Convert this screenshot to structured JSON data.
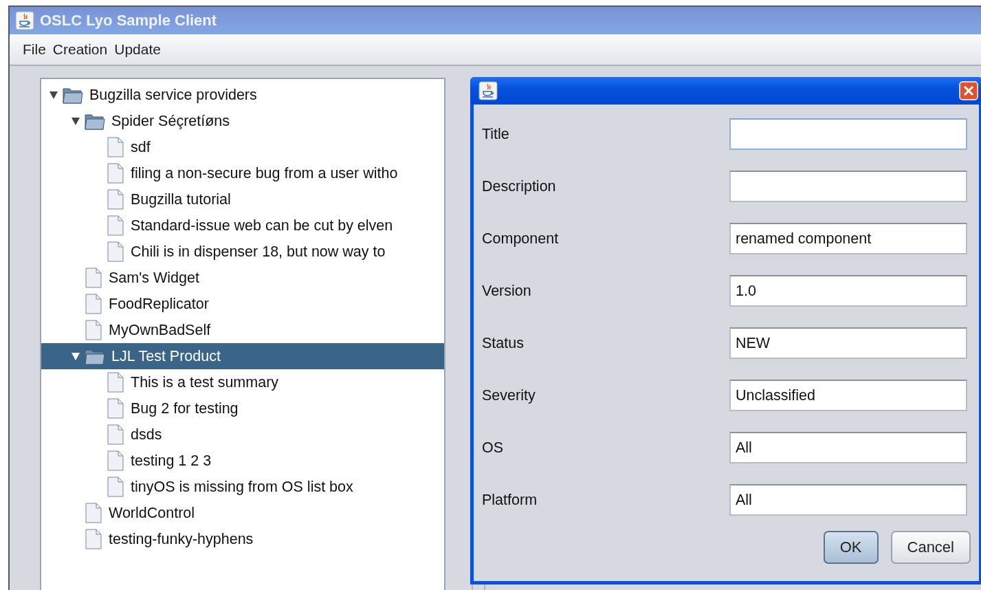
{
  "window": {
    "title": "OSLC Lyo Sample Client"
  },
  "menu": [
    "File",
    "Creation",
    "Update"
  ],
  "tree": [
    {
      "label": "Bugzilla service providers",
      "kind": "folder",
      "expanded": true,
      "selected": false,
      "children": [
        {
          "label": "Spider Séçretíøns",
          "kind": "folder",
          "expanded": true,
          "selected": false,
          "children": [
            {
              "label": "sdf",
              "kind": "file",
              "selected": false
            },
            {
              "label": "filing a non-secure bug from a user witho",
              "kind": "file",
              "selected": false
            },
            {
              "label": "Bugzilla tutorial",
              "kind": "file",
              "selected": false
            },
            {
              "label": "Standard-issue web can be cut by elven",
              "kind": "file",
              "selected": false
            },
            {
              "label": "Chili is in dispenser 18, but now way to",
              "kind": "file",
              "selected": false
            }
          ]
        },
        {
          "label": "Sam's Widget",
          "kind": "file",
          "selected": false
        },
        {
          "label": "FoodReplicator",
          "kind": "file",
          "selected": false
        },
        {
          "label": "MyOwnBadSelf",
          "kind": "file",
          "selected": false
        },
        {
          "label": "LJL Test Product",
          "kind": "folder",
          "expanded": true,
          "selected": true,
          "children": [
            {
              "label": "This is a test summary",
              "kind": "file",
              "selected": false
            },
            {
              "label": "Bug 2 for testing",
              "kind": "file",
              "selected": false
            },
            {
              "label": "dsds",
              "kind": "file",
              "selected": false
            },
            {
              "label": "testing 1 2 3",
              "kind": "file",
              "selected": false
            },
            {
              "label": "tinyOS is missing from OS list box",
              "kind": "file",
              "selected": false
            }
          ]
        },
        {
          "label": "WorldControl",
          "kind": "file",
          "selected": false
        },
        {
          "label": "testing-funky-hyphens",
          "kind": "file",
          "selected": false
        }
      ]
    }
  ],
  "dialog": {
    "fields": [
      {
        "label": "Title",
        "focused": true
      },
      {
        "label": "Description",
        "focused": false
      },
      {
        "label": "Component",
        "value": "renamed component",
        "focused": false
      },
      {
        "label": "Version",
        "value": "1.0",
        "focused": false
      },
      {
        "label": "Status",
        "value": "NEW",
        "focused": false
      },
      {
        "label": "Severity",
        "value": "Unclassified",
        "focused": false
      },
      {
        "label": "OS",
        "value": "All",
        "focused": false
      },
      {
        "label": "Platform",
        "value": "All",
        "focused": false
      }
    ],
    "buttons": [
      {
        "label": "OK",
        "default": true
      },
      {
        "label": "Cancel",
        "default": false
      }
    ]
  }
}
